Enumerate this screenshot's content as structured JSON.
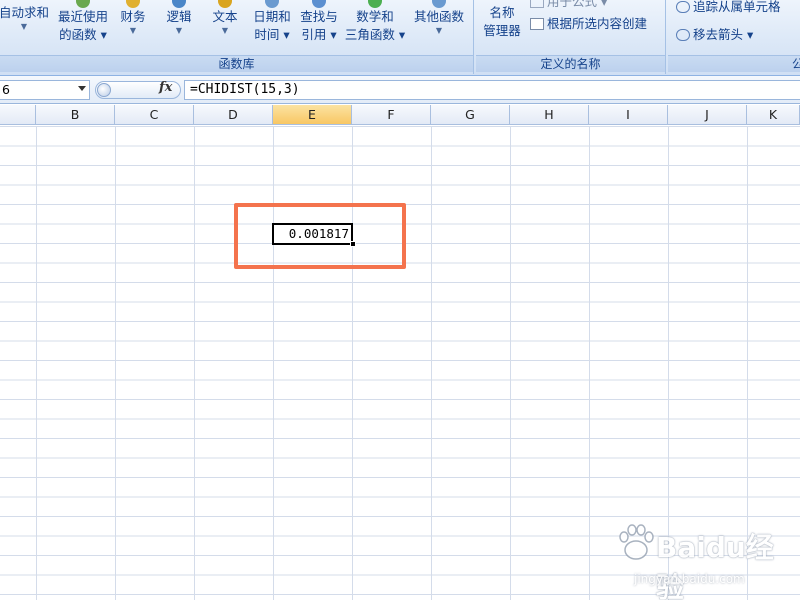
{
  "ribbon": {
    "buttons": [
      {
        "id": "autosum",
        "lines": [
          "自动求和"
        ],
        "has_arrow": true
      },
      {
        "id": "recent",
        "lines": [
          "最近使用",
          "的函数 ▾"
        ],
        "has_arrow": false
      },
      {
        "id": "financial",
        "lines": [
          "财务"
        ],
        "has_arrow": true
      },
      {
        "id": "logical",
        "lines": [
          "逻辑"
        ],
        "has_arrow": true
      },
      {
        "id": "text",
        "lines": [
          "文本"
        ],
        "has_arrow": true
      },
      {
        "id": "datetime",
        "lines": [
          "日期和",
          "时间 ▾"
        ],
        "has_arrow": false
      },
      {
        "id": "lookup",
        "lines": [
          "查找与",
          "引用 ▾"
        ],
        "has_arrow": false
      },
      {
        "id": "math",
        "lines": [
          "数学和",
          "三角函数 ▾"
        ],
        "has_arrow": false
      },
      {
        "id": "more",
        "lines": [
          "其他函数"
        ],
        "has_arrow": true
      }
    ],
    "group_function_library": "函数库",
    "name_manager": [
      "名称",
      "管理器"
    ],
    "use_in_formula": "用于公式 ▾",
    "create_from_selection": "根据所选内容创建",
    "group_defined_names": "定义的名称",
    "trace_precedents": "追踪从属单元格",
    "remove_arrows": "移去箭头 ▾",
    "group_formula_audit": "公"
  },
  "formula_bar": {
    "name_box": "6",
    "fx": "fx",
    "formula": "=CHIDIST(15,3)"
  },
  "columns": [
    "B",
    "C",
    "D",
    "E",
    "F",
    "G",
    "H",
    "I",
    "J",
    "K"
  ],
  "active_column": "E",
  "active_cell_value": "0.001817",
  "watermark": {
    "text": "Baidu经验",
    "sub": "jingyan.baidu.com"
  }
}
